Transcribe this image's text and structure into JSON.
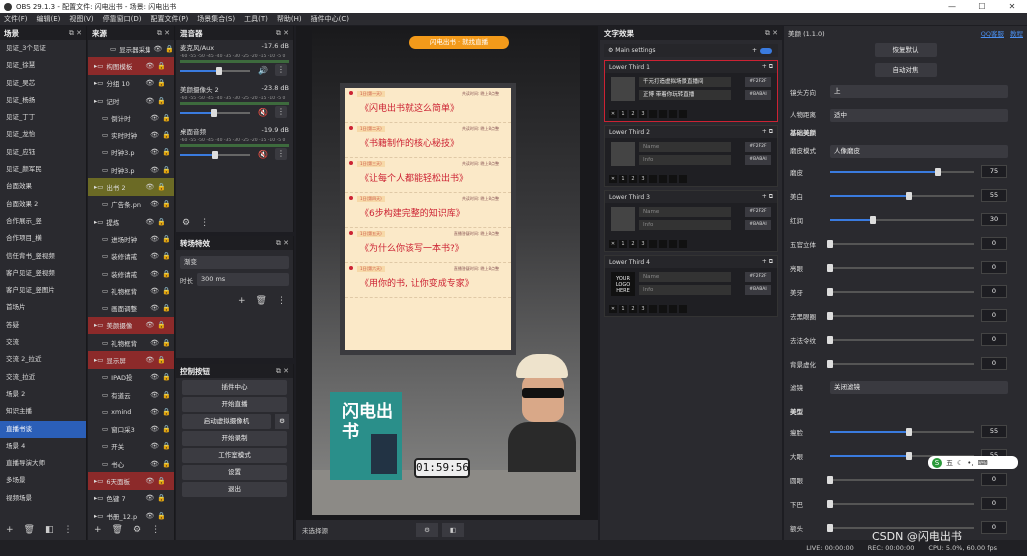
{
  "window": {
    "title": "OBS 29.1.3 - 配置文件: 闪电出书 - 场景: 闪电出书"
  },
  "menu": [
    "文件(F)",
    "编辑(E)",
    "视图(V)",
    "停靠窗口(D)",
    "配置文件(P)",
    "场景集合(S)",
    "工具(T)",
    "帮助(H)",
    "插件中心(C)"
  ],
  "scenes": {
    "title": "场景",
    "items": [
      "见证_3个见证",
      "见证_徐慧",
      "见证_吴芯",
      "见证_杨扬",
      "见证_丁丁",
      "见证_龙怡",
      "见证_应钰",
      "见证_颜军民",
      "台面效果",
      "台面效果 2",
      "合作展示_竖",
      "合作项目_横",
      "信任背书_竖视频",
      "客户见证_竖视频",
      "客户见证_竖图片",
      "首场片",
      "答疑",
      "交流",
      "交流 2_拉近",
      "交流_拉近",
      "场景 2",
      "知识主播",
      "直播书谈",
      "场景 4",
      "直播导演大师",
      "多场景",
      "视频场景"
    ],
    "selected": "直播书谈"
  },
  "sources": {
    "title": "来源",
    "items": [
      {
        "name": "显示器采集",
        "style": "child2"
      },
      {
        "name": "构图模板",
        "style": "grp-red"
      },
      {
        "name": "分组 10",
        "style": "normal"
      },
      {
        "name": "记时",
        "style": "normal"
      },
      {
        "name": "倒计时",
        "style": "child"
      },
      {
        "name": "实时时钟",
        "style": "child"
      },
      {
        "name": "时钟3.p",
        "style": "child"
      },
      {
        "name": "时钟3.p",
        "style": "child"
      },
      {
        "name": "出书 2",
        "style": "grp-olive"
      },
      {
        "name": "广告条.pn",
        "style": "child"
      },
      {
        "name": "提炼",
        "style": "normal"
      },
      {
        "name": "进场时钟",
        "style": "child"
      },
      {
        "name": "装修请戒",
        "style": "child"
      },
      {
        "name": "装修请戒",
        "style": "child"
      },
      {
        "name": "礼物框背",
        "style": "child"
      },
      {
        "name": "画面调整",
        "style": "child"
      },
      {
        "name": "美颜摄像",
        "style": "grp-red"
      },
      {
        "name": "礼物框背",
        "style": "child"
      },
      {
        "name": "显示屏",
        "style": "grp-red"
      },
      {
        "name": "IPAD投",
        "style": "child"
      },
      {
        "name": "有道云",
        "style": "child"
      },
      {
        "name": "xmind",
        "style": "child"
      },
      {
        "name": "窗口采3",
        "style": "child"
      },
      {
        "name": "开关",
        "style": "child"
      },
      {
        "name": "书心",
        "style": "child"
      },
      {
        "name": "6天面板",
        "style": "grp-red"
      },
      {
        "name": "色键 7",
        "style": "normal"
      },
      {
        "name": "书册_12.p",
        "style": "normal"
      }
    ]
  },
  "mixer": {
    "title": "混音器",
    "channels": [
      {
        "name": "麦克风/Aux",
        "db": "-17.6 dB",
        "level": 0.55,
        "muted": false
      },
      {
        "name": "美颜摄像头 2",
        "db": "-23.8 dB",
        "level": 0.48,
        "muted": true
      },
      {
        "name": "桌面音频",
        "db": "-19.9 dB",
        "level": 0.5,
        "muted": true
      }
    ],
    "scale": "-60 -55 -50 -45 -40 -35 -30 -25 -20 -15 -10 -5 0"
  },
  "transitions": {
    "title": "转场特效",
    "type": "渐变",
    "duration_label": "时长",
    "duration": "300 ms"
  },
  "controls": {
    "title": "控制按钮",
    "buttons": [
      "插件中心",
      "开始直播",
      "启动虚拟摄像机",
      "开始录制",
      "工作室模式",
      "设置",
      "退出"
    ]
  },
  "preview": {
    "banner": "闪电出书 · 就找直播",
    "clock": "01:59:56",
    "book_title": "闪电出书",
    "rows": [
      {
        "tag": "1日(第一天)",
        "time": "共读时间: 晚上8点整",
        "title": "《闪电出书就这么简单》"
      },
      {
        "tag": "1日(第二天)",
        "time": "共读时间: 晚上8点整",
        "title": "《书籍制作的核心秘技》"
      },
      {
        "tag": "1日(第三天)",
        "time": "共读时间: 晚上8点整",
        "title": "《让每个人都能轻松出书》"
      },
      {
        "tag": "1日(第四天)",
        "time": "共读时间: 晚上8点整",
        "title": "《6步构建完整的知识库》"
      },
      {
        "tag": "1日(第五天)",
        "time": "直播答疑时间: 晚上8点整",
        "title": "《为什么你该写一本书?》"
      },
      {
        "tag": "1日(第六天)",
        "time": "直播答疑时间: 晚上8点整",
        "title": "《用你的书, 让你变成专家》"
      }
    ]
  },
  "canvas_toolbar": {
    "label": "未选择源"
  },
  "text_effects": {
    "title": "文字效果",
    "main": "Main settings",
    "cards": [
      {
        "name": "Lower Third 1",
        "line1": "千元打造虚拟场景直播间",
        "line2": "正博 带着你玩转直播",
        "c1": "#F2F2F",
        "c2": "#BABAI",
        "active": true
      },
      {
        "name": "Lower Third 2",
        "line1": "Name",
        "line2": "Info",
        "c1": "#F2F2F",
        "c2": "#BABAI",
        "active": false
      },
      {
        "name": "Lower Third 3",
        "line1": "Name",
        "line2": "Info",
        "c1": "#F2F2F",
        "c2": "#BABAI",
        "active": false
      },
      {
        "name": "Lower Third 4",
        "line1": "Name",
        "line2": "Info",
        "c1": "#F2F2F",
        "c2": "#BABAI",
        "active": false,
        "logo": "YOUR LOGO HERE"
      }
    ]
  },
  "beauty": {
    "title": "美颜 (1.1.0)",
    "links": [
      "QQ客服",
      "教程"
    ],
    "btn_reset": "恢复默认",
    "btn_auto": "自动对焦",
    "dir_label": "镜头方向",
    "dir_value": "上",
    "dist_label": "人物距离",
    "dist_value": "适中",
    "section_basic": "基础美颜",
    "mode_label": "磨皮模式",
    "mode_value": "人像磨皮",
    "basic": [
      {
        "label": "磨皮",
        "value": "75",
        "frac": 0.75
      },
      {
        "label": "美白",
        "value": "55",
        "frac": 0.55
      },
      {
        "label": "红润",
        "value": "30",
        "frac": 0.3
      },
      {
        "label": "五官立体",
        "value": "0",
        "frac": 0
      },
      {
        "label": "亮眼",
        "value": "0",
        "frac": 0
      },
      {
        "label": "美牙",
        "value": "0",
        "frac": 0
      },
      {
        "label": "去黑眼圈",
        "value": "0",
        "frac": 0
      },
      {
        "label": "去法令纹",
        "value": "0",
        "frac": 0
      },
      {
        "label": "背景虚化",
        "value": "0",
        "frac": 0
      }
    ],
    "filter_label": "滤镜",
    "filter_value": "关闭滤镜",
    "section_shape": "美型",
    "shape": [
      {
        "label": "瘦脸",
        "value": "55",
        "frac": 0.55
      },
      {
        "label": "大眼",
        "value": "55",
        "frac": 0.55
      },
      {
        "label": "圆眼",
        "value": "0",
        "frac": 0
      },
      {
        "label": "下巴",
        "value": "0",
        "frac": 0
      },
      {
        "label": "额头",
        "value": "0",
        "frac": 0
      }
    ]
  },
  "status": {
    "live": "LIVE: 00:00:00",
    "rec": "REC: 00:00:00",
    "cpu": "CPU: 5.0%, 60.00 fps"
  },
  "ime": {
    "mode": "五"
  },
  "watermark": "CSDN @闪电出书"
}
